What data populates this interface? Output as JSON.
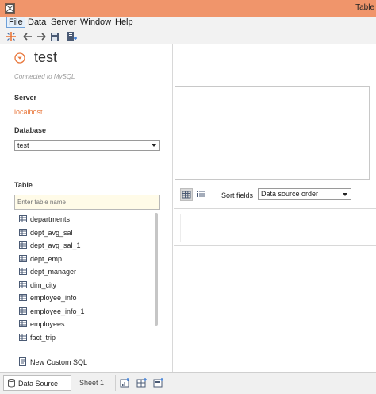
{
  "window": {
    "title": "Table"
  },
  "menu": {
    "items": [
      "File",
      "Data",
      "Server",
      "Window",
      "Help"
    ]
  },
  "toolbar": {
    "buttons": [
      "tableau-logo-icon",
      "back-icon",
      "forward-icon",
      "save-icon",
      "new-datasource-icon"
    ]
  },
  "datasource": {
    "name": "test",
    "connection_status": "Connected to MySQL"
  },
  "server": {
    "label": "Server",
    "value": "localhost"
  },
  "database": {
    "label": "Database",
    "selected": "test"
  },
  "tables": {
    "label": "Table",
    "search_placeholder": "Enter table name",
    "items": [
      "departments",
      "dept_avg_sal",
      "dept_avg_sal_1",
      "dept_emp",
      "dept_manager",
      "dim_city",
      "employee_info",
      "employee_info_1",
      "employees",
      "fact_trip"
    ],
    "custom_sql_label": "New Custom SQL"
  },
  "grid_toolbar": {
    "sort_label": "Sort fields",
    "sort_selected": "Data source order"
  },
  "bottom_tabs": {
    "datasource_label": "Data Source",
    "sheet_label": "Sheet 1"
  },
  "colors": {
    "title_bar": "#f0956b",
    "accent_orange": "#e8763a"
  }
}
